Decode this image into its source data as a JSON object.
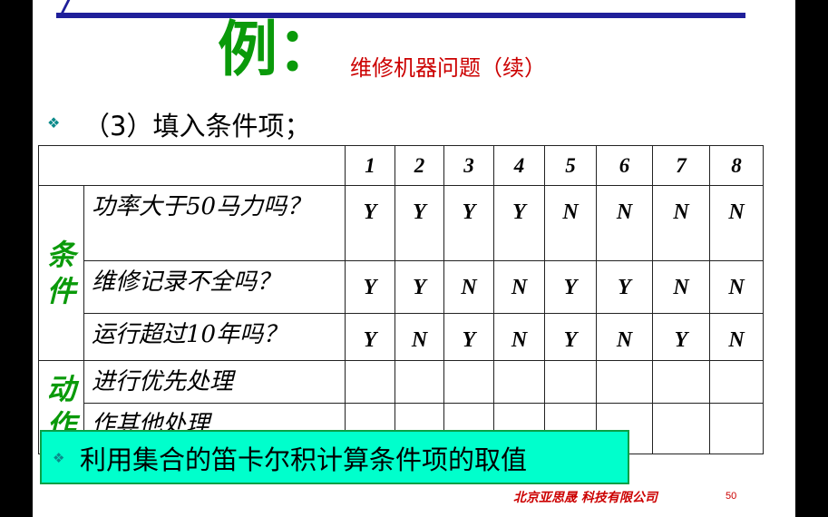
{
  "slide": {
    "title_char": "例",
    "title_colon": "：",
    "subtitle": "维修机器问题（续）",
    "step": "（3）填入条件项；",
    "callout": "利用集合的笛卡尔积计算条件项的取值",
    "company": "北京亚思晟 科技有限公司",
    "page_number": "50",
    "colors": {
      "title": "#0a9a0a",
      "subtitle": "#cc0000",
      "callout_bg": "#00ffcc",
      "rule": "#1f1f9a"
    },
    "bullet_icon": "diamond-bullet-icon"
  },
  "table": {
    "columns": [
      "1",
      "2",
      "3",
      "4",
      "5",
      "6",
      "7",
      "8"
    ],
    "condition_group": [
      "条",
      "件"
    ],
    "action_group": [
      "动",
      "作"
    ],
    "conditions": [
      {
        "label": "功率大于50马力吗？",
        "values": [
          "Y",
          "Y",
          "Y",
          "Y",
          "N",
          "N",
          "N",
          "N"
        ]
      },
      {
        "label": "维修记录不全吗？",
        "values": [
          "Y",
          "Y",
          "N",
          "N",
          "Y",
          "Y",
          "N",
          "N"
        ]
      },
      {
        "label": "运行超过10年吗？",
        "values": [
          "Y",
          "N",
          "Y",
          "N",
          "Y",
          "N",
          "Y",
          "N"
        ]
      }
    ],
    "actions": [
      {
        "label": "进行优先处理"
      },
      {
        "label": "作其他处理"
      }
    ]
  }
}
